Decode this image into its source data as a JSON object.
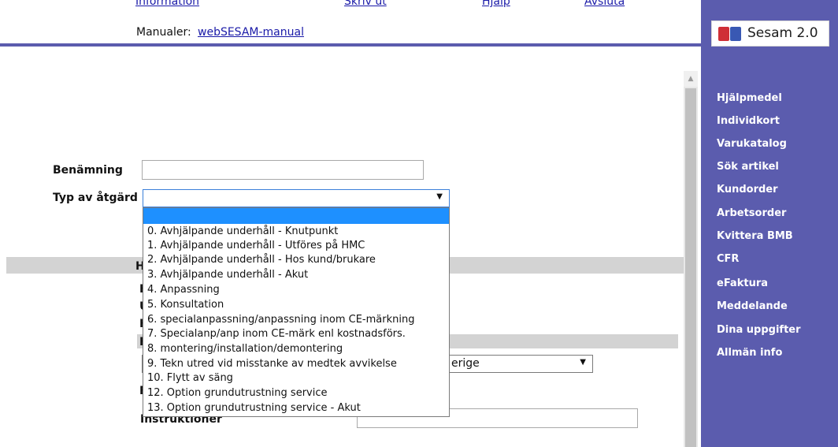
{
  "header": {
    "links": [
      "Information",
      "Skriv ut",
      "Hjälp",
      "Avsluta"
    ],
    "manual_label": "Manualer:",
    "manual_link": "webSESAM-manual"
  },
  "form": {
    "benamning_label": "Benämning",
    "benamning_value": "",
    "typ_label": "Typ av åtgärd",
    "typ_value": "",
    "section_partial": "H",
    "row_partials": [
      "H",
      "U",
      "H",
      "H",
      "F"
    ],
    "region_select_value": "erige",
    "instruktioner_label": "Instruktioner"
  },
  "dropdown": {
    "options": [
      "",
      "0. Avhjälpande underhåll - Knutpunkt",
      "1. Avhjälpande underhåll - Utföres på HMC",
      "2. Avhjälpande underhåll - Hos kund/brukare",
      "3. Avhjälpande underhåll - Akut",
      "4. Anpassning",
      "5. Konsultation",
      "6. specialanpassning/anpassning inom CE-märkning",
      "7. Specialanp/anp inom CE-märk enl kostnadsförs.",
      "8. montering/installation/demontering",
      "9. Tekn utred vid misstanke av medtek avvikelse",
      "10. Flytt av säng",
      "12. Option grundutrustning service",
      "13. Option grundutrustning service - Akut"
    ],
    "selected_index": 0,
    "highlight_color": "#1e90ff"
  },
  "sidebar": {
    "logo_text": "Sesam 2.0",
    "items": [
      "Hjälpmedel",
      "Individkort",
      "Varukatalog",
      "Sök artikel",
      "Kundorder",
      "Arbetsorder",
      "Kvittera BMB",
      "CFR",
      "eFaktura",
      "Meddelande",
      "Dina uppgifter",
      "Allmän info"
    ],
    "bg_color": "#5b5cae"
  },
  "icons": {
    "select_arrow": "chevron-down-icon",
    "scroll_up": "scroll-up-arrow-icon"
  }
}
